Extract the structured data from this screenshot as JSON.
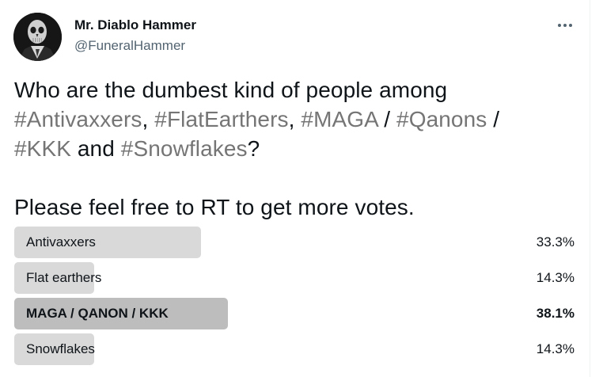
{
  "author": {
    "name": "Mr. Diablo Hammer",
    "handle": "@FuneralHammer"
  },
  "more_icon": "more-dots-icon",
  "tweet": {
    "line1_a": "Who are the dumbest kind of people among",
    "line2_tag1": "#Antivaxxers",
    "line2_sep1": ", ",
    "line2_tag2": "#FlatEarthers",
    "line2_sep2": ", ",
    "line2_tag3": "#MAGA",
    "line2_sep3": " / ",
    "line2_tag4": "#Qanons",
    "line2_sep4": " /",
    "line3_tag1": "#KKK",
    "line3_mid": " and ",
    "line3_tag2": "#Snowflakes",
    "line3_end": "?",
    "line5": "Please feel free to RT to get more votes."
  },
  "colors": {
    "hashtag": "#757575",
    "bar": "#d9d9d9",
    "bar_winner": "#bdbdbd"
  },
  "poll": {
    "options": [
      {
        "label": "Antivaxxers",
        "percent": "33.3%",
        "fraction": 0.333,
        "winner": false
      },
      {
        "label": "Flat earthers",
        "percent": "14.3%",
        "fraction": 0.143,
        "winner": false
      },
      {
        "label": "MAGA / QANON / KKK",
        "percent": "38.1%",
        "fraction": 0.381,
        "winner": true
      },
      {
        "label": "Snowflakes",
        "percent": "14.3%",
        "fraction": 0.143,
        "winner": false
      }
    ]
  }
}
